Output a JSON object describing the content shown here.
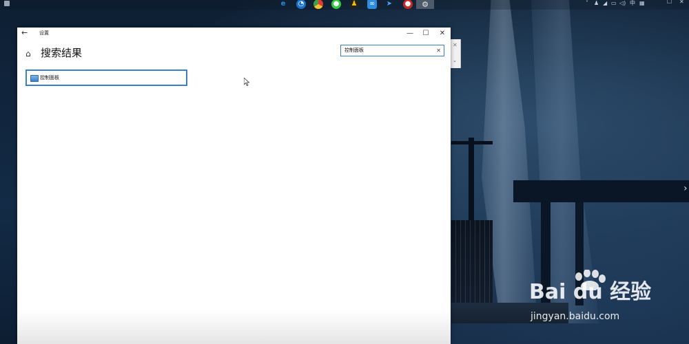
{
  "window": {
    "title": "设置",
    "page_title": "搜索结果",
    "controls": {
      "minimize": "—",
      "maximize": "☐",
      "close": "✕"
    }
  },
  "search": {
    "value": "控制面板",
    "clear_icon": "✕"
  },
  "results": [
    {
      "label": "控制面板",
      "icon": "control-panel-icon"
    }
  ],
  "taskbar": {
    "apps": [
      "edge-icon",
      "tencent-icon",
      "chrome-icon",
      "wechat-icon",
      "qq-icon",
      "baidu-netdisk-icon",
      "feishu-icon",
      "steam-icon",
      "recorder-icon",
      "settings-icon"
    ],
    "tray_ime": "中"
  },
  "watermark": {
    "brand": "Bai du 经验",
    "url": "jingyan.baidu.com"
  },
  "colors": {
    "accent": "#3a7fc7",
    "window_bg": "#ffffff"
  }
}
